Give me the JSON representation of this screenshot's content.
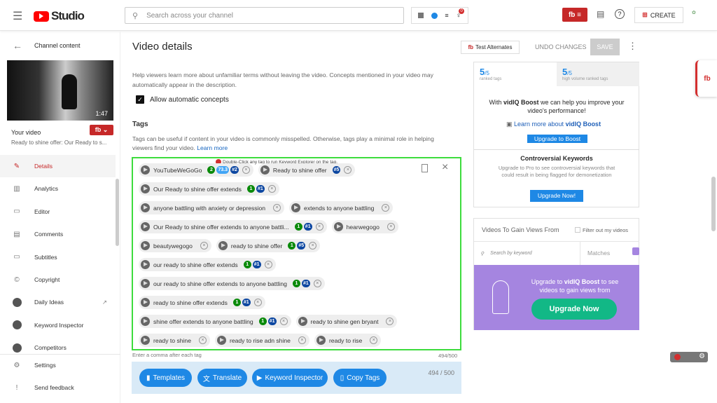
{
  "topbar": {
    "brand": "Studio",
    "search_placeholder": "Search across your channel",
    "notif_count": "0",
    "create_label": "CREATE"
  },
  "sidebar": {
    "back_label": "Channel content",
    "duration": "1:47",
    "your_video": "Your video",
    "video_title": "Ready to shine offer: Our Ready to s...",
    "items": [
      {
        "label": "Details",
        "icon": "pencil-icon"
      },
      {
        "label": "Analytics",
        "icon": "analytics-icon"
      },
      {
        "label": "Editor",
        "icon": "editor-icon"
      },
      {
        "label": "Comments",
        "icon": "comments-icon"
      },
      {
        "label": "Subtitles",
        "icon": "subtitles-icon"
      },
      {
        "label": "Copyright",
        "icon": "copyright-icon"
      },
      {
        "label": "Daily Ideas",
        "icon": "vidiq-icon"
      },
      {
        "label": "Keyword Inspector",
        "icon": "vidiq-icon"
      },
      {
        "label": "Competitors",
        "icon": "vidiq-icon"
      }
    ],
    "settings": "Settings",
    "feedback": "Send feedback"
  },
  "header": {
    "title": "Video details",
    "test_alternates": "Test Alternates",
    "undo": "UNDO CHANGES",
    "save": "SAVE"
  },
  "concepts": {
    "description": "Help viewers learn more about unfamiliar terms without leaving the video. Concepts mentioned in your video may automatically appear in the description.",
    "checkbox_label": "Allow automatic concepts",
    "checked": true
  },
  "tags_section": {
    "title": "Tags",
    "description": "Tags can be useful if content in your video is commonly misspelled. Otherwise, tags play a minimal role in helping viewers find your video.",
    "learn_more": "Learn more",
    "hint": "Double-Click any tag to run Keyword Explorer on the tag.",
    "helper": "Enter a comma after each tag",
    "count": "494/500",
    "count2": "494 / 500",
    "tags": [
      {
        "text": "YouTubeWeGoGo",
        "count": "2",
        "score": "73.3",
        "rank": "#2"
      },
      {
        "text": "Ready to shine offer",
        "rank": "#5"
      },
      {
        "text": "Our Ready to shine offer extends",
        "count": "1",
        "rank": "#1"
      },
      {
        "text": "anyone battling with anxiety or depression"
      },
      {
        "text": "extends to anyone battling"
      },
      {
        "text": "Our Ready to shine offer extends to anyone battli...",
        "count": "1",
        "rank": "#1"
      },
      {
        "text": "hearwegogo"
      },
      {
        "text": "beautywegogo"
      },
      {
        "text": "ready to shine offer",
        "count": "1",
        "rank": "#5"
      },
      {
        "text": "our ready to shine offer extends",
        "count": "1",
        "rank": "#1"
      },
      {
        "text": "our ready to shine offer extends to anyone battling",
        "count": "1",
        "rank": "#1"
      },
      {
        "text": "ready to shine offer extends",
        "count": "1",
        "rank": "#1"
      },
      {
        "text": "shine offer extends to anyone battling",
        "count": "1",
        "rank": "#1"
      },
      {
        "text": "ready to shine gen bryant"
      },
      {
        "text": "ready to shine"
      },
      {
        "text": "ready to rise adn shine"
      },
      {
        "text": "ready to rise"
      }
    ],
    "buttons": {
      "templates": "Templates",
      "translate": "Translate",
      "keyword_inspector": "Keyword Inspector",
      "copy_tags": "Copy Tags"
    }
  },
  "right": {
    "ranked": "5",
    "ranked_of": "/5",
    "ranked_label": "ranked tags",
    "hv": "5",
    "hv_of": "/5",
    "hv_label": "high volume ranked tags",
    "boost_pre": "With ",
    "boost_brand": "vidIQ Boost",
    "boost_post": " we can help you improve your video's performance!",
    "learn_pre": "Learn more about ",
    "learn_brand": "vidIQ Boost",
    "upgrade_boost": "Upgrade to Boost",
    "controversial_title": "Controversial Keywords",
    "controversial_desc": "Upgrade to Pro to see controversial keywords that could result in being flagged for demonetization",
    "upgrade_now_small": "Upgrade Now!",
    "gain_title": "Videos To Gain Views From",
    "filter_label": "Filter out my videos",
    "search_placeholder": "Search by keyword",
    "matches": "Matches",
    "promo_pre": "Upgrade to ",
    "promo_brand": "vidIQ Boost",
    "promo_post": " to see videos to gain views from",
    "upgrade_now": "Upgrade Now"
  },
  "colors": {
    "accent": "#1e88e5",
    "red": "#c62828",
    "green": "#0a8a0a",
    "purple": "#a585e0",
    "teal": "#12b886",
    "tag_border": "#3ddc3d"
  }
}
